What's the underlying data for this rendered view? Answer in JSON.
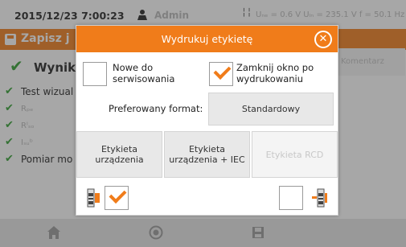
{
  "status": {
    "time": "2015/12/23 7:00:23",
    "user": "Admin",
    "readings": "Uₙₑ = 0.6 V Uₗₙ = 235.1 V f = 50.1 Hz"
  },
  "background": {
    "title": "Zapisz j",
    "result_title": "Wynik",
    "comment_tab": "Komentarz",
    "tests": [
      {
        "label": "Test wizual",
        "dim": false
      },
      {
        "label": "Rₚₑ",
        "dim": true
      },
      {
        "label": "Rᴵₛₒ",
        "dim": true
      },
      {
        "label": "Iₛᵤᵇ",
        "dim": true
      },
      {
        "label": "Pomiar mo",
        "dim": false
      }
    ]
  },
  "dialog": {
    "title": "Wydrukuj etykietę",
    "option_service": {
      "label": "Nowe do serwisowania",
      "checked": false
    },
    "option_close": {
      "label": "Zamknij okno po wydrukowaniu",
      "checked": true
    },
    "format_label": "Preferowany format:",
    "format_value": "Standardowy",
    "buttons": {
      "device": "Etykieta urządzenia",
      "device_iec": "Etykieta urządzenia + IEC",
      "rcd": "Etykieta RCD"
    },
    "left_printer_checked": true,
    "right_printer_checked": false
  },
  "colors": {
    "accent": "#f07c1a",
    "check_green": "#2e9e2e"
  },
  "icons": [
    "user-icon",
    "meter-icon",
    "save-icon",
    "close-icon",
    "printer-icon",
    "home-icon",
    "record-icon",
    "disk-icon"
  ]
}
